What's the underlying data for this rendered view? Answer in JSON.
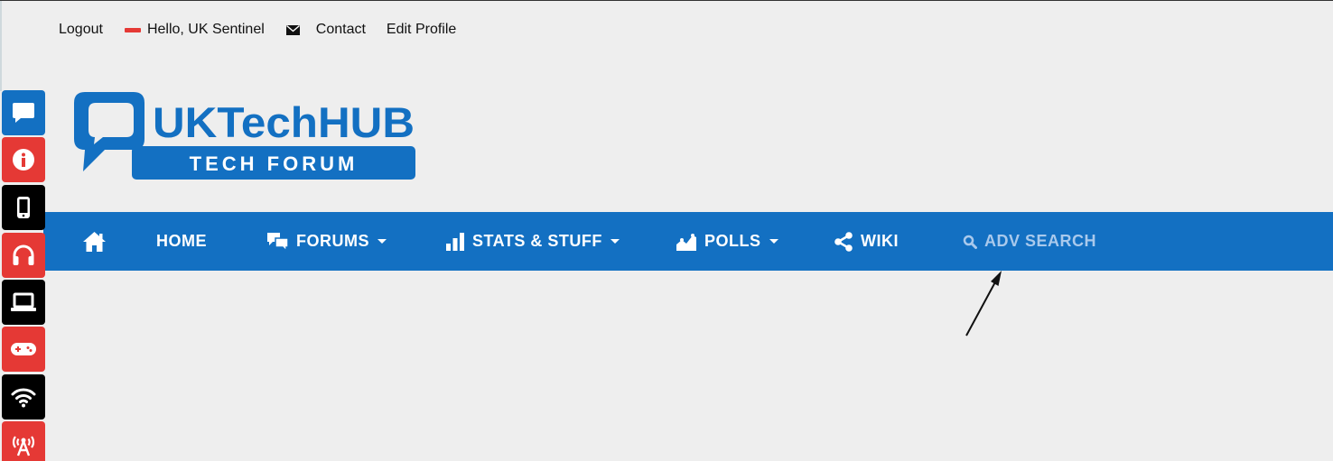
{
  "top_links": {
    "logout": "Logout",
    "greeting": "Hello, UK Sentinel",
    "contact": "Contact",
    "edit_profile": "Edit Profile"
  },
  "logo": {
    "brand": "UKTechHUB",
    "tagline": "TECH FORUM"
  },
  "nav": {
    "home_icon": "home-icon",
    "home": "HOME",
    "forums": "FORUMS",
    "stats": "STATS & STUFF",
    "polls": "POLLS",
    "wiki": "WIKI",
    "adv_search": "ADV SEARCH"
  },
  "sidebar": {
    "items": [
      {
        "icon": "chat-icon",
        "color": "#1370c2"
      },
      {
        "icon": "info-icon",
        "color": "#e53935"
      },
      {
        "icon": "mobile-phone-icon",
        "color": "#000000"
      },
      {
        "icon": "headphones-icon",
        "color": "#e53935"
      },
      {
        "icon": "laptop-icon",
        "color": "#000000"
      },
      {
        "icon": "gamepad-icon",
        "color": "#e53935"
      },
      {
        "icon": "wifi-icon",
        "color": "#000000"
      },
      {
        "icon": "broadcast-tower-icon",
        "color": "#e53935"
      }
    ]
  },
  "colors": {
    "brand_blue": "#1370c2",
    "accent_red": "#e53935",
    "background": "#eeeeee",
    "adv_search_text": "#a9c9ec"
  }
}
